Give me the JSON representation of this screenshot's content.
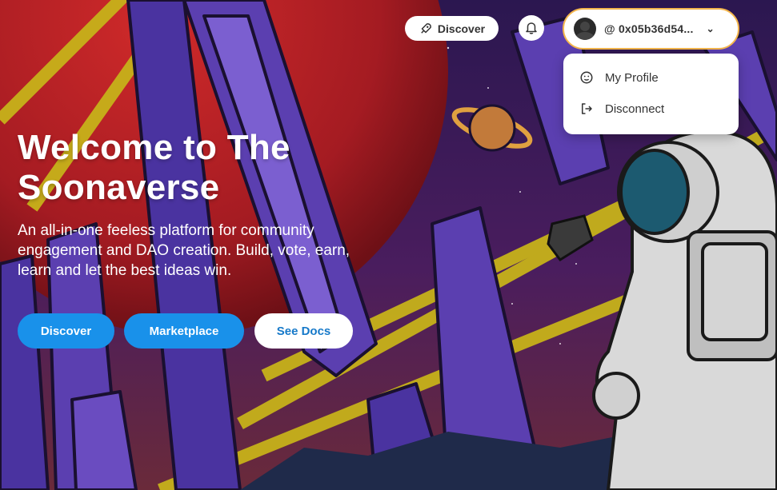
{
  "header": {
    "discover_label": "Discover",
    "account_address": "@ 0x05b36d54...",
    "icons": [
      "rocket-icon",
      "bell-icon",
      "avatar",
      "chevron-down-icon"
    ]
  },
  "account_menu": {
    "items": [
      {
        "label": "My Profile",
        "icon": "smiley-icon"
      },
      {
        "label": "Disconnect",
        "icon": "logout-icon"
      }
    ]
  },
  "hero": {
    "title_line1": "Welcome to The",
    "title_line2": "Soonaverse",
    "description": "An all-in-one feeless platform for community engagement and DAO creation. Build, vote, earn, learn and let the best ideas win.",
    "buttons": {
      "discover": "Discover",
      "marketplace": "Marketplace",
      "docs": "See Docs"
    }
  },
  "colors": {
    "primary_button": "#1991ea",
    "account_border": "#f4b64c",
    "sky": "#3a1e63"
  }
}
